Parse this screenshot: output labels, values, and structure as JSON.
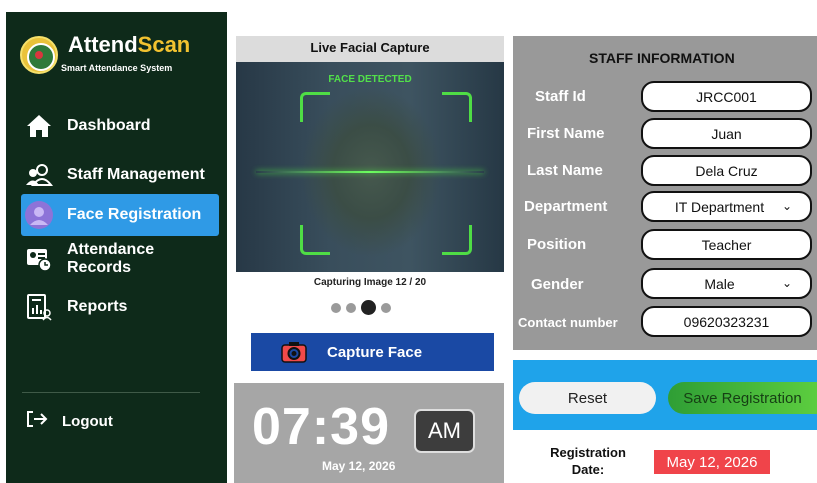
{
  "app": {
    "brand_part1": "Attend",
    "brand_part2": "Scan",
    "subtitle": "Smart Attendance System"
  },
  "sidebar": {
    "items": [
      {
        "label": "Dashboard",
        "icon": "home-icon",
        "active": false
      },
      {
        "label": "Staff Management",
        "icon": "users-icon",
        "active": false
      },
      {
        "label": "Face Registration",
        "icon": "face-scan-icon",
        "active": true
      },
      {
        "label": "Attendance Records",
        "icon": "records-icon",
        "active": false
      },
      {
        "label": "Reports",
        "icon": "report-icon",
        "active": false
      }
    ],
    "logout_label": "Logout",
    "logout_icon": "logout-icon"
  },
  "camera": {
    "title": "Live Facial Capture",
    "status": "FACE DETECTED",
    "progress_text": "Capturing Image 12 / 20",
    "captured": 12,
    "total": 20,
    "dot_count": 4,
    "active_dot": 3,
    "capture_button": "Capture Face",
    "capture_icon": "camera-icon"
  },
  "clock": {
    "time": "07:39",
    "ampm": "AM",
    "date": "May 12, 2026"
  },
  "staff": {
    "title": "STAFF INFORMATION",
    "fields": [
      {
        "label": "Staff Id",
        "value": "JRCC001",
        "type": "text"
      },
      {
        "label": "First Name",
        "value": "Juan",
        "type": "text"
      },
      {
        "label": "Last Name",
        "value": "Dela Cruz",
        "type": "text"
      },
      {
        "label": "Department",
        "value": "IT Department",
        "type": "select"
      },
      {
        "label": "Position",
        "value": "Teacher",
        "type": "text"
      },
      {
        "label": "Gender",
        "value": "Male",
        "type": "select"
      },
      {
        "label": "Contact number",
        "value": "09620323231",
        "type": "text"
      }
    ]
  },
  "actions": {
    "reset_label": "Reset",
    "save_label": "Save Registration"
  },
  "registration": {
    "label_line1": "Registration",
    "label_line2": "Date:",
    "date": "May 12, 2026"
  },
  "colors": {
    "sidebar_bg": "#0e2a1a",
    "brand_accent": "#f2c230",
    "active_nav": "#2f9ae6",
    "detect_green": "#4fdd45",
    "capture_button": "#1a49a4",
    "actions_bg": "#1fa3ea",
    "save_button": "#4cbf3b",
    "reg_date_bg": "#f0444a"
  }
}
